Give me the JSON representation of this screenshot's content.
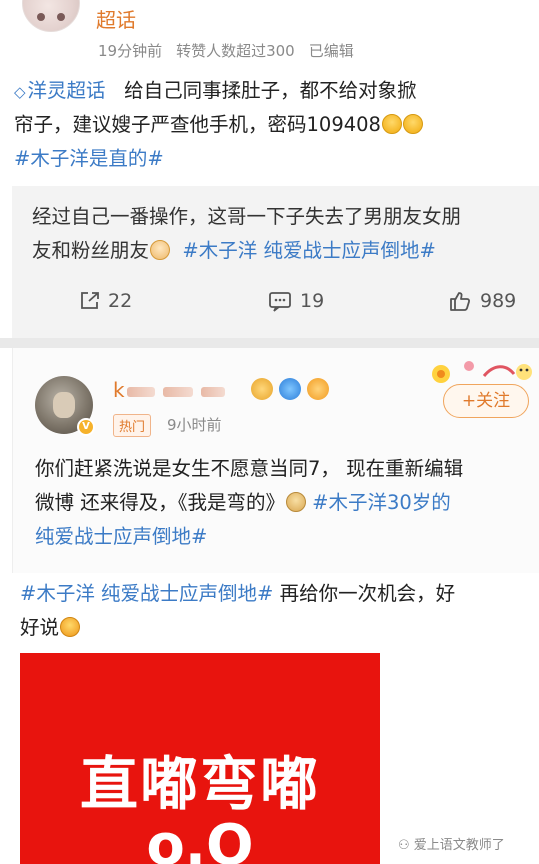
{
  "post1": {
    "username": "超话",
    "meta": [
      "19分钟前",
      "转赞人数超过300",
      "已编辑"
    ],
    "topic": "洋灵超话",
    "lines": [
      "给自己同事揉肚子，都不给对象掀",
      "帘子，建议嫂子严查他手机，密码109408",
      "#木子洋是直的#"
    ]
  },
  "quote": {
    "lines": [
      "经过自己一番操作，这哥一下子失去了男朋友女朋",
      "友和粉丝朋友"
    ],
    "hashtag": "#木子洋 纯爱战士应声倒地#",
    "actions": {
      "share": "22",
      "comment": "19",
      "like": "989"
    }
  },
  "post2": {
    "username_visible": "k",
    "hot_label": "热门",
    "time": "9小时前",
    "follow_label": "+关注",
    "lines": [
      "你们赶紧洗说是女生不愿意当同7，  现在重新编辑",
      "微博 还来得及，《我是弯的》",
      "纯爱战士应声倒地#"
    ],
    "hashtag": "#木子洋30岁的"
  },
  "post3": {
    "hashtag": "#木子洋 纯爱战士应声倒地#",
    "text1": " 再给你一次机会，好",
    "text2": "好说",
    "image_text": "直嘟弯嘟",
    "image_face": "o.O"
  },
  "watermark": "爱上语文教师了",
  "colors": {
    "accent": "#e07a2c",
    "link": "#3c7bc6",
    "red": "#e8140e"
  },
  "icons": [
    "diamond-icon",
    "share-icon",
    "comment-icon",
    "like-icon",
    "vip-badge-icon"
  ]
}
